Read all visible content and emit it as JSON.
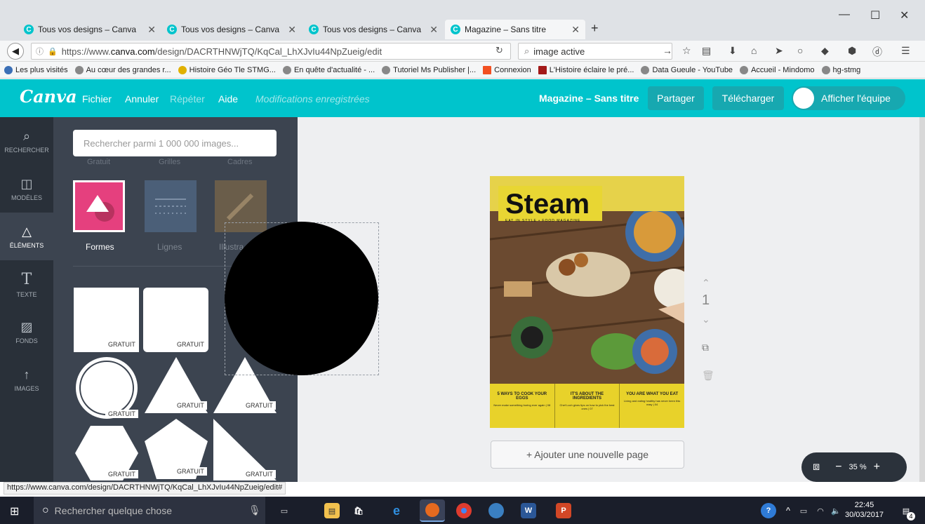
{
  "browser": {
    "tabs": [
      {
        "label": "Tous vos designs – Canva"
      },
      {
        "label": "Tous vos designs – Canva"
      },
      {
        "label": "Tous vos designs – Canva"
      },
      {
        "label": "Magazine – Sans titre"
      }
    ],
    "url_prefix": "https://www.",
    "url_domain": "canva.com",
    "url_path": "/design/DACRTHNWjTQ/KqCal_LhXJvIu44NpZueig/edit",
    "search_value": "image active",
    "bookmarks": [
      "Les plus visités",
      "Au cœur des grandes r...",
      "Histoire Géo Tle STMG...",
      "En quête d'actualité - ...",
      "Tutoriel Ms Publisher |...",
      "Connexion",
      "L'Histoire éclaire le pré...",
      "Data Gueule - YouTube",
      "Accueil - Mindomo",
      "hg-stmg"
    ]
  },
  "canva": {
    "logo": "Canva",
    "menu": {
      "file": "Fichier",
      "undo": "Annuler",
      "redo": "Répéter",
      "help": "Aide",
      "saved": "Modifications enregistrées"
    },
    "doc_title": "Magazine – Sans titre",
    "share": "Partager",
    "download": "Télécharger",
    "team": "Afficher l'équipe"
  },
  "rail": [
    {
      "label": "RECHERCHER",
      "icon": "search-icon"
    },
    {
      "label": "MODÈLES",
      "icon": "layout-icon"
    },
    {
      "label": "ÉLÉMENTS",
      "icon": "shapes-icon"
    },
    {
      "label": "TEXTE",
      "icon": "text-icon"
    },
    {
      "label": "FONDS",
      "icon": "background-icon"
    },
    {
      "label": "IMAGES",
      "icon": "upload-icon"
    }
  ],
  "panel": {
    "search_placeholder": "Rechercher parmi 1 000 000 images...",
    "subtabs": [
      "Gratuit",
      "Grilles",
      "Cadres"
    ],
    "categories": [
      "Formes",
      "Lignes",
      "Illustra"
    ],
    "free_label": "GRATUIT"
  },
  "magazine": {
    "title": "Steam",
    "subtitle": "EAT IN STYLE • FOOD MAGAZINE",
    "columns": [
      {
        "head": "5 WAYS TO COOK YOUR EGGS",
        "text": "Never make something boring ever again | 08"
      },
      {
        "head": "IT'S ABOUT THE INGREDIENTS",
        "text": "Chef Loch gives tips on how to pick the best ones | 07"
      },
      {
        "head": "YOU ARE WHAT YOU EAT",
        "text": "Living and eating healthy has never been this easy | 04"
      }
    ]
  },
  "workspace": {
    "page_number": "1",
    "add_page": "+ Ajouter une nouvelle page",
    "zoom": "35 %"
  },
  "status_url": "https://www.canva.com/design/DACRTHNWjTQ/KqCal_LhXJvIu44NpZueig/edit#",
  "taskbar": {
    "search_placeholder": "Rechercher quelque chose",
    "time": "22:45",
    "date": "30/03/2017",
    "notif": "4"
  },
  "colors": {
    "brand": "#00c4cc",
    "panel": "#3c4450",
    "rail": "#293039"
  }
}
